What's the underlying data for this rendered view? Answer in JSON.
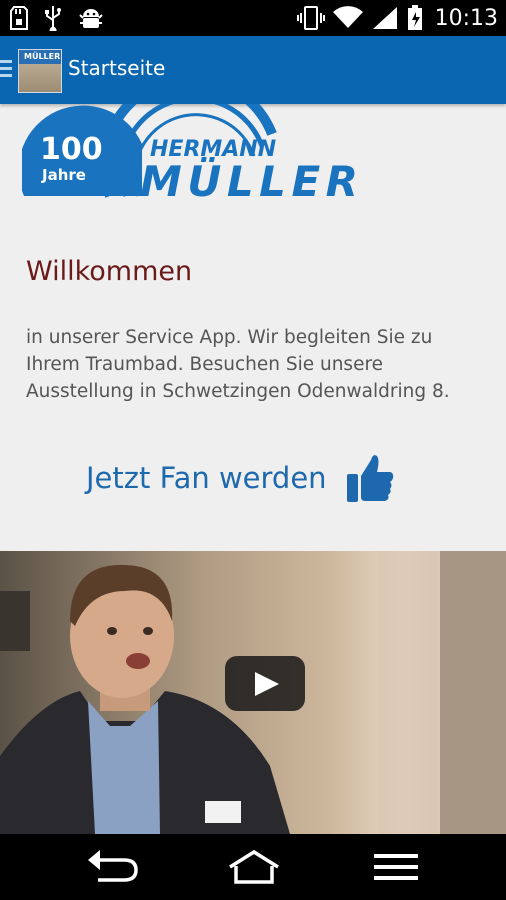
{
  "status_bar": {
    "time": "10:13",
    "icons": [
      "sd-card-icon",
      "usb-icon",
      "android-debug-icon",
      "vibrate-icon",
      "wifi-icon",
      "signal-icon",
      "battery-icon"
    ]
  },
  "action_bar": {
    "title": "Startseite",
    "app_icon_text": "MÜLLER",
    "color": "#0a66b1"
  },
  "logo": {
    "badge_number": "100",
    "badge_word": "Jahre",
    "brand_top": "HERMANN",
    "brand_bottom": "MÜLLER",
    "color": "#1a73bf"
  },
  "content": {
    "heading": "Willkommen",
    "intro": "in unserer Service App. Wir begleiten Sie zu Ihrem Traumbad. Besuchen Sie unsere Ausstellung in Schwetzingen Odenwaldring 8.",
    "fan_link": "Jetzt Fan werden",
    "heading_color": "#6b1a1a",
    "link_color": "#1e69ad"
  },
  "video": {
    "play_icon": "play-icon"
  },
  "nav_bar": {
    "icons": [
      "back-icon",
      "home-icon",
      "menu-icon"
    ]
  }
}
